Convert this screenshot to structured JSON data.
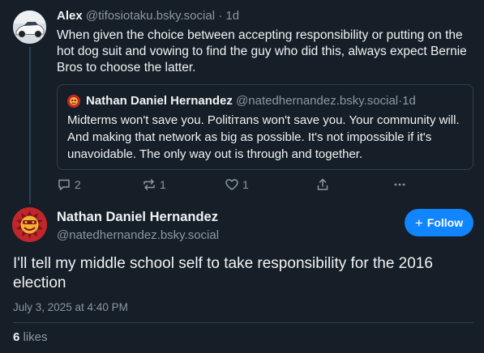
{
  "parent_post": {
    "author_name": "Alex",
    "author_handle": "@tifosiotaku.bsky.social",
    "separator": "·",
    "age": "1d",
    "text": "When given the choice between accepting responsibility or putting on the hot dog suit and vowing to find the guy who did this, always expect Bernie Bros to choose the latter.",
    "quoted_post": {
      "author_name": "Nathan Daniel Hernandez",
      "author_handle": "@natedhernandez.bsky.social",
      "separator": "·",
      "age": "1d",
      "text": "Midterms won't save you. Politiтans won't save you. Your community will. And making that network as big as possible. It's not impossible if it's unavoidable. The only way out is through and together."
    },
    "actions": {
      "reply_count": "2",
      "repost_count": "1",
      "like_count": "1"
    }
  },
  "main_post": {
    "author_name": "Nathan Daniel Hernandez",
    "author_handle": "@natedhernandez.bsky.social",
    "follow_label": "Follow",
    "text": "I'll tell my middle school self to take responsibility for the 2016 election",
    "timestamp": "July 3, 2025 at 4:40 PM",
    "likes_count": "6",
    "likes_label": "likes"
  },
  "colors": {
    "background": "#161e27",
    "muted_text": "#8b98a5",
    "border": "#2e4052",
    "accent": "#1185fe"
  }
}
